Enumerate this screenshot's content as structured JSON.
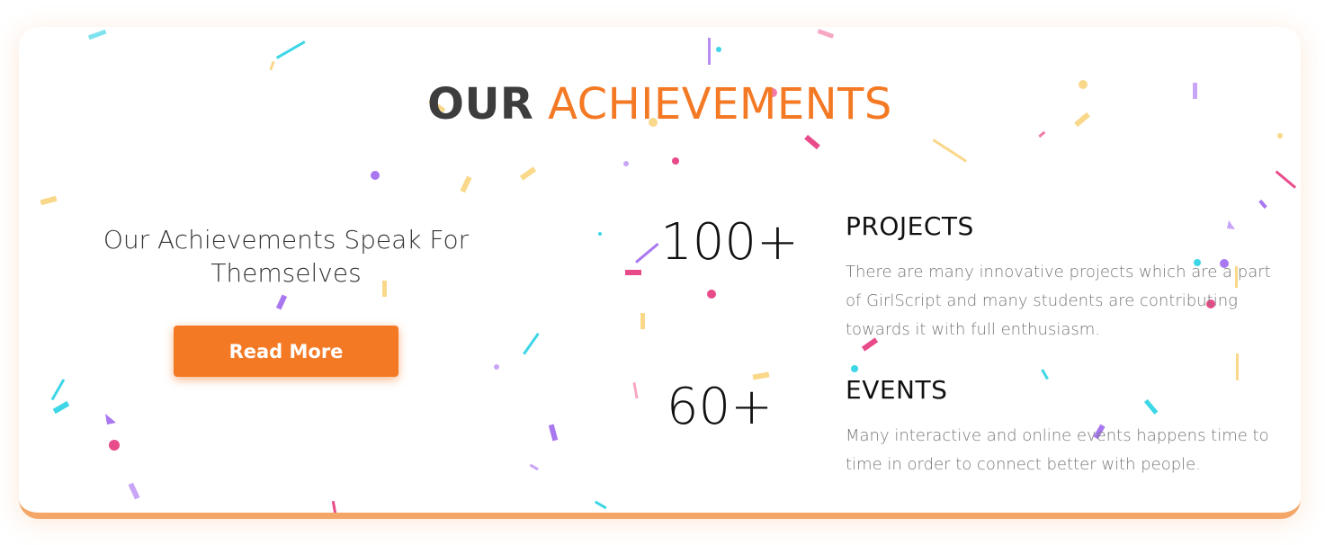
{
  "section": {
    "title_dark": "OUR",
    "title_accent": "ACHIEVEMENTS",
    "tagline": "Our Achievements Speak For Themselves",
    "read_more_label": "Read More"
  },
  "stats": [
    {
      "number": "100+",
      "title": "PROJECTS",
      "description": "There are many innovative projects which are a part of GirlScript and many students are contributing towards it with full enthusiasm."
    },
    {
      "number": "60+",
      "title": "EVENTS",
      "description": "Many interactive and online events happens time to time in order to connect better with people."
    }
  ],
  "colors": {
    "accent": "#f47924",
    "title_dark": "#3d3d3d",
    "card_border": "#f3a666",
    "confetti": [
      "#f27ba8",
      "#a978f0",
      "#3dd6e6",
      "#f9d88a",
      "#e84b8a"
    ]
  }
}
